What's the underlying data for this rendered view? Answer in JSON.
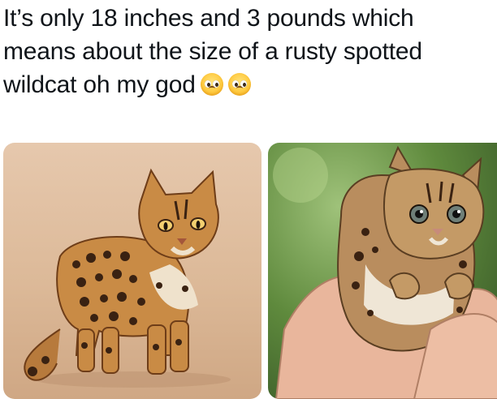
{
  "tweet": {
    "text_lines": [
      "It’s only 18 inches and 3 pounds which",
      "means about the size of a rusty spotted",
      "wildcat oh my god"
    ],
    "emojis": [
      "pleading-face-emoji",
      "pleading-face-emoji"
    ]
  },
  "media": {
    "images": [
      {
        "subject": "leopard-cat-standing-on-beige-background"
      },
      {
        "subject": "leopard-cat-kitten-held-in-hands"
      }
    ]
  },
  "colors": {
    "text": "#0f1419",
    "left_bg": "#dcb998",
    "right_bg": "#5f8a3d"
  }
}
